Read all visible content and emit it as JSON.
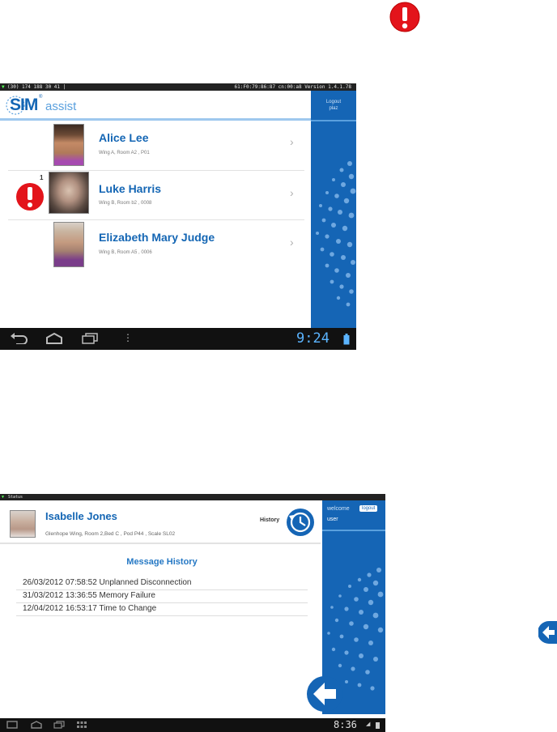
{
  "screen1": {
    "status_left": "(30) 174 188 30 41 |",
    "status_right": "61:F0:79:86:87 cn:00:a8    Version  1.4.1.78",
    "logout_line1": "Logout",
    "logout_line2": "plaz",
    "logo_sim": "SIM",
    "logo_assist": "assist",
    "patients": [
      {
        "name": "Alice Lee",
        "location": "Wing A, Room A2 , P01",
        "alert": false
      },
      {
        "name": "Luke Harris",
        "location": "Wing B, Room b2 , 0008",
        "alert": true,
        "alert_count": "1"
      },
      {
        "name": "Elizabeth Mary Judge",
        "location": "Wing B, Room A5 , 0006",
        "alert": false
      }
    ],
    "clock": "9:24"
  },
  "screen2": {
    "status_left": "Status",
    "patient_name": "Isabelle Jones",
    "patient_location": "Glenhope Wing, Room 2,Bed C , Pod P44 , Scale SL02",
    "history_label": "History",
    "welcome": "welcome",
    "user": "user",
    "logout": "logout",
    "section_title": "Message History",
    "messages": [
      "26/03/2012 07:58:52 Unplanned Disconnection",
      "31/03/2012 13:36:55 Memory Failure",
      "12/04/2012 16:53:17 Time to Change"
    ],
    "clock": "8:36"
  },
  "colors": {
    "brand_blue": "#1565b5",
    "alert_red": "#e3141b",
    "name_blue": "#1466b4"
  },
  "icons": [
    "alert-icon",
    "chevron-right-icon",
    "history-clock-icon",
    "back-arrow-icon",
    "nav-back-icon",
    "nav-home-icon",
    "nav-recent-icon",
    "battery-icon"
  ]
}
